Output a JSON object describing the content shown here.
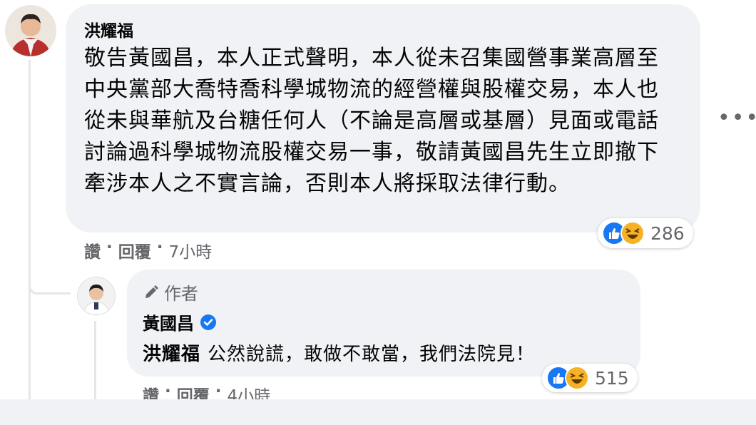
{
  "comment": {
    "author": "洪耀福",
    "text": "敬告黃國昌，本人正式聲明，本人從未召集國營事業高層至中央黨部大喬特喬科學城物流的經營權與股權交易，本人也從未與華航及台糖任何人（不論是高層或基層）見面或電話討論過科學城物流股權交易一事，敬請黃國昌先生立即撤下牽涉本人之不實言論，否則本人將採取法律行動。",
    "like_label": "讚",
    "reply_label": "回覆",
    "time": "7小時",
    "reaction_count": "286",
    "more_icon": "more-horizontal-icon"
  },
  "reply": {
    "badge_label": "作者",
    "author": "黃國昌",
    "mention": "洪耀福",
    "text": "公然說謊，敢做不敢當，我們法院見！",
    "like_label": "讚",
    "reply_label": "回覆",
    "time": "4小時",
    "reaction_count": "515"
  },
  "colors": {
    "bubble": "#f0f2f5",
    "like_blue": "#1877f2",
    "haha_yellow": "#f7b125",
    "meta_gray": "#65676b"
  }
}
